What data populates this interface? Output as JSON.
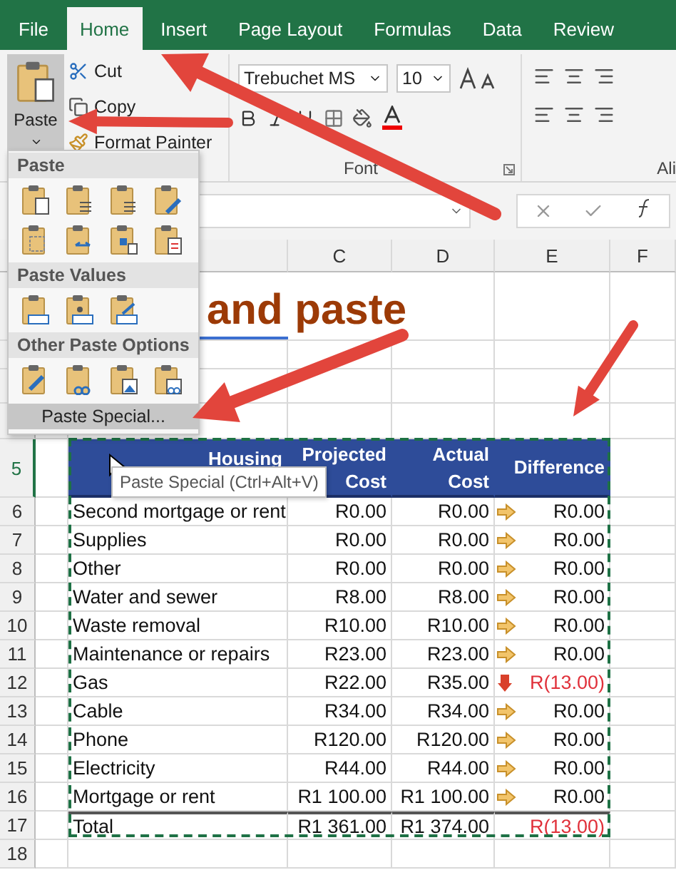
{
  "tabs": [
    {
      "label": "File",
      "selected": false
    },
    {
      "label": "Home",
      "selected": true
    },
    {
      "label": "Insert",
      "selected": false
    },
    {
      "label": "Page Layout",
      "selected": false
    },
    {
      "label": "Formulas",
      "selected": false
    },
    {
      "label": "Data",
      "selected": false
    },
    {
      "label": "Review",
      "selected": false
    }
  ],
  "clipboard": {
    "paste": "Paste",
    "cut": "Cut",
    "copy": "Copy",
    "format_painter": "Format Painter"
  },
  "font": {
    "name": "Trebuchet MS",
    "size": "10",
    "group_label": "Font"
  },
  "alignment": {
    "group_label": "Ali"
  },
  "paste_menu": {
    "sections": [
      {
        "title": "Paste"
      },
      {
        "title": "Paste Values"
      },
      {
        "title": "Other Paste Options"
      }
    ],
    "special": {
      "label": "Paste Special...",
      "selected": true
    }
  },
  "tooltip": "Paste Special (Ctrl+Alt+V)",
  "columns": [
    "C",
    "D",
    "E",
    "F"
  ],
  "sheet_title": "and paste",
  "row_numbers": [
    {
      "label": "5",
      "selected": true
    },
    {
      "label": "6",
      "selected": false
    },
    {
      "label": "7",
      "selected": false
    },
    {
      "label": "8",
      "selected": false
    },
    {
      "label": "9",
      "selected": false
    },
    {
      "label": "10",
      "selected": false
    },
    {
      "label": "11",
      "selected": false
    },
    {
      "label": "12",
      "selected": false
    },
    {
      "label": "13",
      "selected": false
    },
    {
      "label": "14",
      "selected": false
    },
    {
      "label": "15",
      "selected": false
    },
    {
      "label": "16",
      "selected": false
    },
    {
      "label": "17",
      "selected": false
    },
    {
      "label": "18",
      "selected": false
    }
  ],
  "table": {
    "headers": [
      "Housing",
      "Projected Cost",
      "Actual Cost",
      "Difference"
    ],
    "rows": [
      {
        "kind": "item",
        "item": "Second mortgage or rent",
        "projected": "R0.00",
        "actual": "R0.00",
        "difference": "R0.00",
        "negative": false
      },
      {
        "kind": "item",
        "item": "Supplies",
        "projected": "R0.00",
        "actual": "R0.00",
        "difference": "R0.00",
        "negative": false
      },
      {
        "kind": "item",
        "item": "Other",
        "projected": "R0.00",
        "actual": "R0.00",
        "difference": "R0.00",
        "negative": false
      },
      {
        "kind": "item",
        "item": "Water and sewer",
        "projected": "R8.00",
        "actual": "R8.00",
        "difference": "R0.00",
        "negative": false
      },
      {
        "kind": "item",
        "item": "Waste removal",
        "projected": "R10.00",
        "actual": "R10.00",
        "difference": "R0.00",
        "negative": false
      },
      {
        "kind": "item",
        "item": "Maintenance or repairs",
        "projected": "R23.00",
        "actual": "R23.00",
        "difference": "R0.00",
        "negative": false
      },
      {
        "kind": "item",
        "item": "Gas",
        "projected": "R22.00",
        "actual": "R35.00",
        "difference": "R(13.00)",
        "negative": true
      },
      {
        "kind": "item",
        "item": "Cable",
        "projected": "R34.00",
        "actual": "R34.00",
        "difference": "R0.00",
        "negative": false
      },
      {
        "kind": "item",
        "item": "Phone",
        "projected": "R120.00",
        "actual": "R120.00",
        "difference": "R0.00",
        "negative": false
      },
      {
        "kind": "item",
        "item": "Electricity",
        "projected": "R44.00",
        "actual": "R44.00",
        "difference": "R0.00",
        "negative": false
      },
      {
        "kind": "item",
        "item": "Mortgage or rent",
        "projected": "R1 100.00",
        "actual": "R1 100.00",
        "difference": "R0.00",
        "negative": false
      },
      {
        "kind": "total",
        "item": "Total",
        "projected": "R1 361.00",
        "actual": "R1 374.00",
        "difference": "R(13.00)",
        "negative": true
      }
    ]
  }
}
